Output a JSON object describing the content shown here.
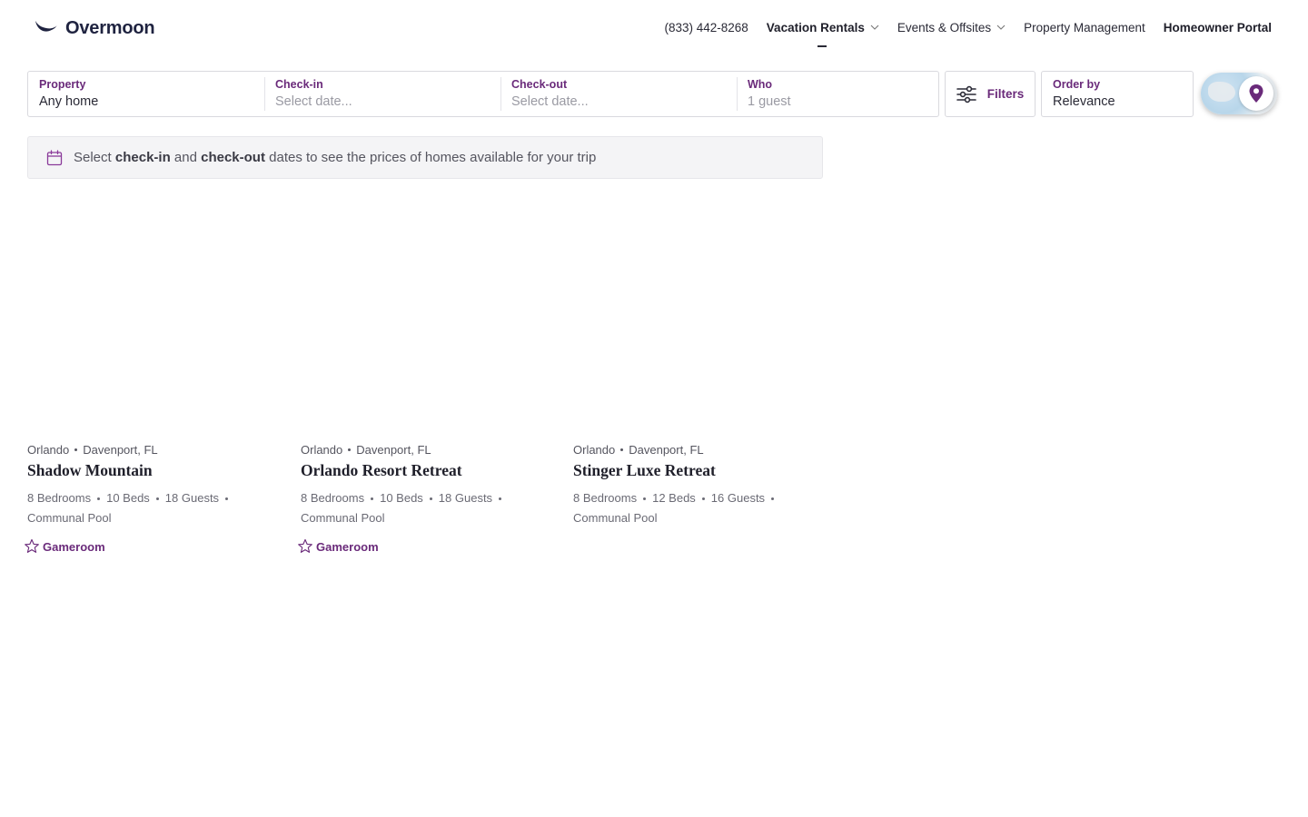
{
  "brand": {
    "name": "Overmoon",
    "color": "#1f2340"
  },
  "nav": {
    "phone": "(833) 442-8268",
    "vacation_rentals": "Vacation Rentals",
    "events_offsites": "Events & Offsites",
    "property_management": "Property Management",
    "homeowner_portal": "Homeowner Portal"
  },
  "search": {
    "property": {
      "label": "Property",
      "value": "Any home"
    },
    "checkin": {
      "label": "Check-in",
      "placeholder": "Select date..."
    },
    "checkout": {
      "label": "Check-out",
      "placeholder": "Select date..."
    },
    "who": {
      "label": "Who",
      "placeholder": "1 guest"
    },
    "filters_label": "Filters",
    "order_by": {
      "label": "Order by",
      "value": "Relevance"
    }
  },
  "banner": {
    "prefix": "Select",
    "checkin": "check-in",
    "and": "and",
    "checkout": "check-out",
    "suffix": "dates to see the prices of homes available for your trip"
  },
  "listings": [
    {
      "city": "Orlando",
      "area": "Davenport, FL",
      "title": "Shadow Mountain",
      "bedrooms": "8 Bedrooms",
      "beds": "10 Beds",
      "guests": "18 Guests",
      "feature": "Communal Pool",
      "amenity": "Gameroom"
    },
    {
      "city": "Orlando",
      "area": "Davenport, FL",
      "title": "Orlando Resort Retreat",
      "bedrooms": "8 Bedrooms",
      "beds": "10 Beds",
      "guests": "18 Guests",
      "feature": "Communal Pool",
      "amenity": "Gameroom"
    },
    {
      "city": "Orlando",
      "area": "Davenport, FL",
      "title": "Stinger Luxe Retreat",
      "bedrooms": "8 Bedrooms",
      "beds": "12 Beds",
      "guests": "16 Guests",
      "feature": "Communal Pool",
      "amenity": ""
    }
  ],
  "colors": {
    "accent": "#6a2a7a",
    "text": "#2a2a36",
    "muted": "#6a6a74",
    "border": "#d9d9de"
  },
  "icons": [
    "moon-logo-icon",
    "chevron-down-icon",
    "filter-sliders-icon",
    "calendar-icon",
    "map-pin-icon",
    "star-icon"
  ]
}
